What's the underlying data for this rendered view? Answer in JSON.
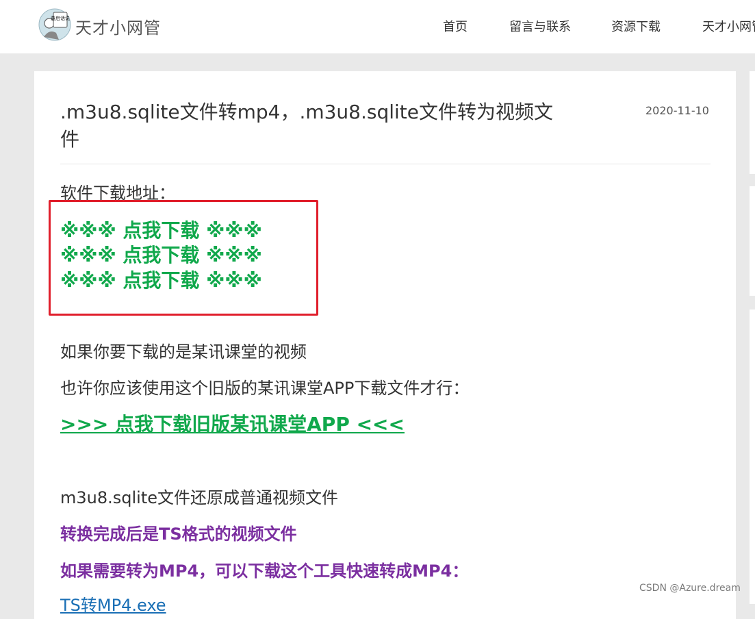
{
  "header": {
    "logo_text": "董启话说",
    "site_name": "天才小网管",
    "nav": [
      "首页",
      "留言与联系",
      "资源下载",
      "天才小网管"
    ]
  },
  "article": {
    "title": ".m3u8.sqlite文件转mp4，.m3u8.sqlite文件转为视频文件",
    "date": "2020-11-10",
    "download_label": "软件下载地址：",
    "download_links": [
      "※※※ 点我下载 ※※※",
      "※※※ 点我下载 ※※※",
      "※※※ 点我下载 ※※※"
    ],
    "para1": "如果你要下载的是某讯课堂的视频",
    "para2": "也许你应该使用这个旧版的某讯课堂APP下载文件才行：",
    "old_app_link": ">>>  点我下载旧版某讯课堂APP  <<<",
    "para3": "m3u8.sqlite文件还原成普通视频文件",
    "purple1": "转换完成后是TS格式的视频文件",
    "purple2": "如果需要转为MP4，可以下载这个工具快速转成MP4：",
    "ts_link": "TS转MP4.exe"
  },
  "watermark": "CSDN @Azure.dream",
  "colors": {
    "background": "#e9e9e9",
    "download_green": "#10a84b",
    "highlight_red": "#e01e2b",
    "purple": "#7b2fa0",
    "link_blue": "#1a6fb5"
  }
}
